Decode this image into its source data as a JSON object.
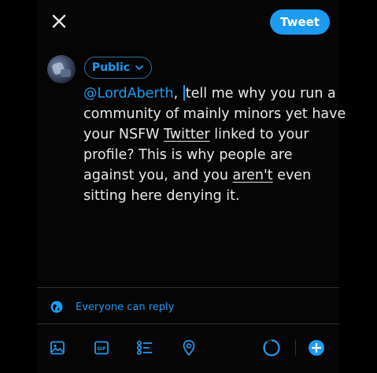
{
  "compose": {
    "tweet_label": "Tweet",
    "audience_label": "Public",
    "text": {
      "mention": "@LordAberth",
      "seg1": ", ",
      "seg2": "tell me why you run a",
      "line2": "community of mainly minors yet have",
      "line3a": "your NSFW ",
      "link1": "Twitter",
      "line3b": " linked to your",
      "line4": "profile? This is why people are",
      "line5a": "against you, and you ",
      "link2": "aren't",
      "line5b": " even",
      "line6": "sitting here denying it."
    },
    "reply_setting": "Everyone can reply"
  },
  "toolbar": {
    "icons": [
      "image-icon",
      "gif-icon",
      "poll-icon",
      "location-icon",
      "character-count-ring",
      "add-thread-icon"
    ],
    "gif_glyph": "GIF"
  },
  "colors": {
    "accent": "#1d9bf0",
    "background": "#000000",
    "text": "#e7e9ea",
    "divider": "#2f3336"
  }
}
